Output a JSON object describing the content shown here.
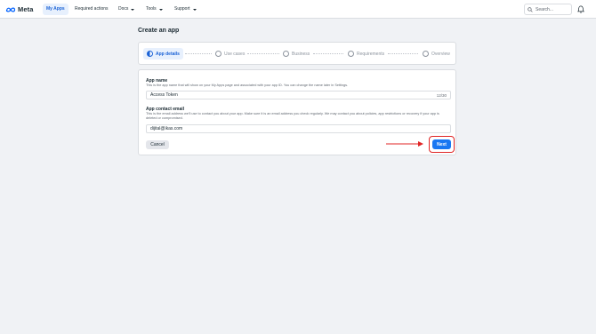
{
  "nav": {
    "brand": "Meta",
    "items": [
      {
        "label": "My Apps",
        "active": true
      },
      {
        "label": "Required actions"
      },
      {
        "label": "Docs"
      },
      {
        "label": "Tools"
      },
      {
        "label": "Support"
      }
    ],
    "search_placeholder": "Search..."
  },
  "page": {
    "title": "Create an app"
  },
  "stepper": {
    "steps": [
      {
        "label": "App details",
        "active": true
      },
      {
        "label": "Use cases"
      },
      {
        "label": "Business"
      },
      {
        "label": "Requirements"
      },
      {
        "label": "Overview"
      }
    ]
  },
  "form": {
    "app_name_label": "App name",
    "app_name_help": "This is the app name that will show on your My Apps page and associated with your app ID. You can change the name later in Settings.",
    "app_name_value": "Access Token",
    "app_name_counter": "12/30",
    "email_label": "App contact email",
    "email_help": "This is the email address we'll use to contact you about your app. Make sure it is an email address you check regularly. We may contact you about policies, app restrictions or recovery if your app is deleted or compromised.",
    "email_value": "dijital@ikas.com",
    "cancel_label": "Cancel",
    "next_label": "Next"
  },
  "colors": {
    "accent": "#1877f2",
    "highlight": "#e02424"
  }
}
